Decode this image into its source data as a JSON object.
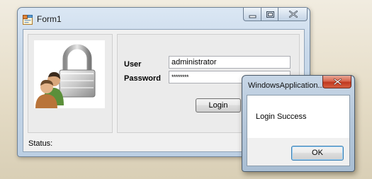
{
  "main_window": {
    "title": "Form1",
    "icon": "form-app-icon",
    "caption_buttons": [
      "minimize-icon",
      "maximize-icon",
      "close-icon"
    ]
  },
  "picture": {
    "icon": "users-lock-icon"
  },
  "login_form": {
    "user_label": "User",
    "user_value": "administrator",
    "password_label": "Password",
    "password_value": "********",
    "login_button": "Login"
  },
  "status_bar": {
    "label": "Status:"
  },
  "message_box": {
    "title": "WindowsApplication...",
    "message": "Login Success",
    "ok_button": "OK",
    "close_icon": "close-icon"
  },
  "colors": {
    "close_button_red": "#c0381f",
    "window_frame_blue": "#bccfe3"
  }
}
